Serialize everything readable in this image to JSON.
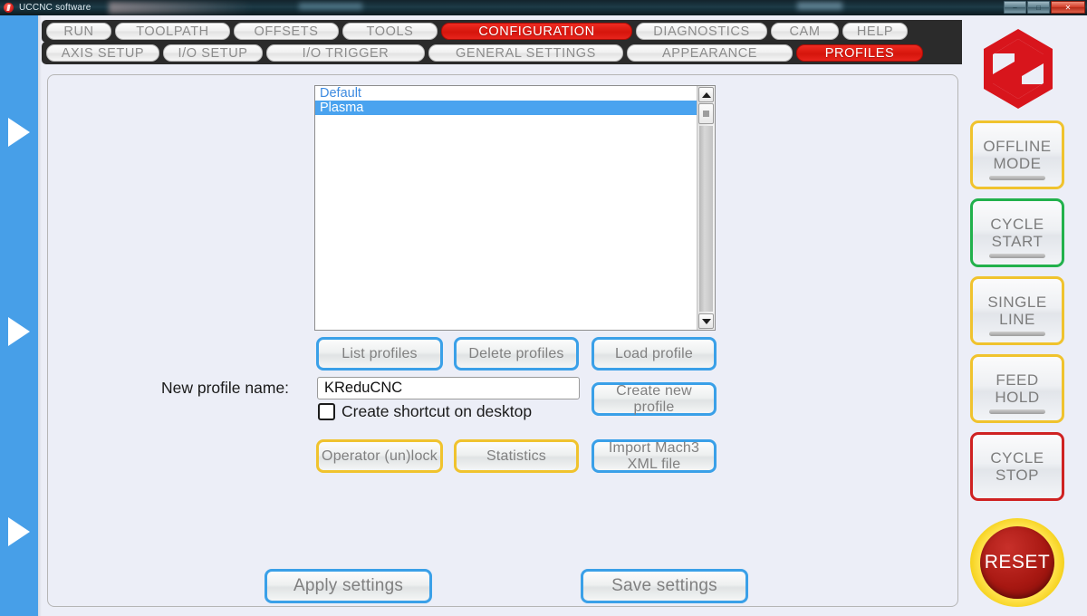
{
  "window": {
    "title": "UCCNC software",
    "icon": "app-icon",
    "controls": {
      "minimize": "–",
      "maximize": "□",
      "close": "✕"
    }
  },
  "left_rail": {
    "arrows": [
      "play-arrow-1",
      "play-arrow-2",
      "play-arrow-3"
    ]
  },
  "tabs_row1": [
    {
      "label": "RUN",
      "active": false
    },
    {
      "label": "TOOLPATH",
      "active": false
    },
    {
      "label": "OFFSETS",
      "active": false
    },
    {
      "label": "TOOLS",
      "active": false
    },
    {
      "label": "CONFIGURATION",
      "active": true
    },
    {
      "label": "DIAGNOSTICS",
      "active": false
    },
    {
      "label": "CAM",
      "active": false
    },
    {
      "label": "HELP",
      "active": false
    }
  ],
  "tabs_row2": [
    {
      "label": "AXIS SETUP",
      "active": false
    },
    {
      "label": "I/O SETUP",
      "active": false
    },
    {
      "label": "I/O  TRIGGER",
      "active": false
    },
    {
      "label": "GENERAL SETTINGS",
      "active": false
    },
    {
      "label": "APPEARANCE",
      "active": false
    },
    {
      "label": "PROFILES",
      "active": true
    }
  ],
  "profile_list": {
    "items": [
      {
        "name": "Default",
        "selected": false
      },
      {
        "name": "Plasma",
        "selected": true
      }
    ]
  },
  "buttons": {
    "list_profiles": "List profiles",
    "delete_profiles": "Delete profiles",
    "load_profile": "Load profile",
    "create_new_profile": "Create new profile",
    "operator_unlock": "Operator (un)lock",
    "statistics": "Statistics",
    "import_mach3": "Import Mach3\nXML file",
    "apply_settings": "Apply settings",
    "save_settings": "Save settings"
  },
  "new_profile": {
    "label": "New profile name:",
    "value": "KReduCNC",
    "placeholder": "",
    "shortcut_label": "Create shortcut on desktop",
    "shortcut_checked": false
  },
  "sidebar": {
    "buttons": [
      {
        "label": "OFFLINE\nMODE",
        "accent": "#f0c32e"
      },
      {
        "label": "CYCLE\nSTART",
        "accent": "#22b14c"
      },
      {
        "label": "SINGLE\nLINE",
        "accent": "#f0c32e"
      },
      {
        "label": "FEED\nHOLD",
        "accent": "#f0c32e"
      },
      {
        "label": "CYCLE\nSTOP",
        "accent": "#cf2222"
      }
    ],
    "reset": {
      "label": "RESET",
      "accent": "#f5d21f"
    },
    "logo": "uccnc-hex-logo"
  },
  "colors": {
    "accent_blue": "#3aa0e8",
    "accent_gold": "#f0c32e",
    "accent_red": "#d5150c",
    "accent_green": "#22b14c",
    "rail_blue": "#479fe8",
    "panel_bg": "#eceef7",
    "selection_blue": "#4aa3ef",
    "list_text_blue": "#3c8ae0"
  }
}
